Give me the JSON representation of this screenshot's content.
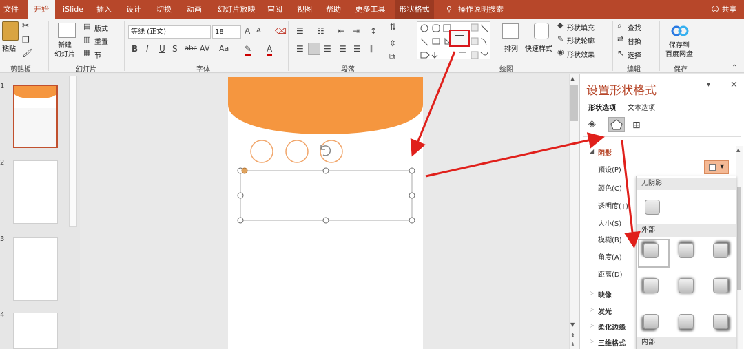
{
  "tabs": [
    {
      "label": "文件",
      "active": false
    },
    {
      "label": "开始",
      "active": true
    },
    {
      "label": "iSlide",
      "active": false
    },
    {
      "label": "插入",
      "active": false
    },
    {
      "label": "设计",
      "active": false
    },
    {
      "label": "切换",
      "active": false
    },
    {
      "label": "动画",
      "active": false
    },
    {
      "label": "幻灯片放映",
      "active": false
    },
    {
      "label": "审阅",
      "active": false
    },
    {
      "label": "视图",
      "active": false
    },
    {
      "label": "帮助",
      "active": false
    },
    {
      "label": "更多工具",
      "active": false
    },
    {
      "label": "形状格式",
      "active": false
    }
  ],
  "tell_me": "操作说明搜索",
  "share": "共享",
  "ribbon": {
    "paste": "粘贴",
    "new_slide": "新建\n幻灯片",
    "layout": "版式",
    "reset": "重置",
    "section": "节",
    "font_name": "等线 (正文)",
    "font_size": "18",
    "shape_fill": "形状填充",
    "shape_outline": "形状轮廓",
    "shape_effects": "形状效果",
    "arrange": "排列",
    "quick_styles": "快速样式",
    "find": "查找",
    "replace": "替换",
    "select": "选择",
    "save_to_baidu": "保存到\n百度网盘",
    "groups": {
      "clipboard": "剪贴板",
      "slides": "幻灯片",
      "font": "字体",
      "paragraph": "段落",
      "drawing": "绘图",
      "editing": "编辑",
      "save": "保存"
    }
  },
  "thumbnails": [
    "1",
    "2",
    "3",
    "4"
  ],
  "pane": {
    "title": "设置形状格式",
    "tab_shape": "形状选项",
    "tab_text": "文本选项",
    "section_shadow": "阴影",
    "props": [
      "预设(P)",
      "颜色(C)",
      "透明度(T)",
      "大小(S)",
      "模糊(B)",
      "角度(A)",
      "距离(D)"
    ],
    "sections": [
      "映像",
      "发光",
      "柔化边缘",
      "三维格式"
    ]
  },
  "gallery": {
    "no_shadow": "无阴影",
    "outer": "外部",
    "inner": "内部"
  },
  "colors": {
    "accent": "#b7472a",
    "orange": "#f5963f",
    "arrow": "#e0201b"
  }
}
